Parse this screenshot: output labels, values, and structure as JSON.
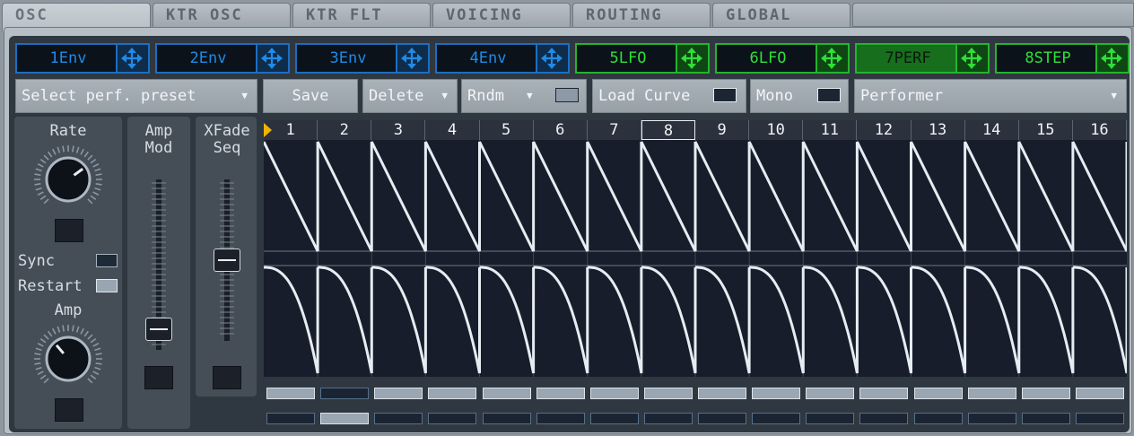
{
  "tabs": [
    "OSC",
    "KTR OSC",
    "KTR FLT",
    "VOICING",
    "ROUTING",
    "GLOBAL"
  ],
  "active_tab": "OSC",
  "mod_sources": [
    {
      "label": "1Env",
      "kind": "env",
      "selected": false
    },
    {
      "label": "2Env",
      "kind": "env",
      "selected": false
    },
    {
      "label": "3Env",
      "kind": "env",
      "selected": false
    },
    {
      "label": "4Env",
      "kind": "env",
      "selected": false
    },
    {
      "label": "5LFO",
      "kind": "lfo",
      "selected": false
    },
    {
      "label": "6LFO",
      "kind": "lfo",
      "selected": false
    },
    {
      "label": "7PERF",
      "kind": "lfo",
      "selected": true
    },
    {
      "label": "8STEP",
      "kind": "lfo",
      "selected": false
    }
  ],
  "toolbar": {
    "preset_select": "Select perf. preset",
    "save": "Save",
    "delete": "Delete",
    "rndm": "Rndm",
    "load_curve": "Load Curve",
    "mono": "Mono",
    "mode_select": "Performer"
  },
  "left_panel": {
    "rate_label": "Rate",
    "sync_label": "Sync",
    "restart_label": "Restart",
    "amp_label": "Amp",
    "rate_value": 0.7,
    "amp_value": 0.35,
    "sync_on": false,
    "restart_on": true
  },
  "amp_mod": {
    "label_line1": "Amp",
    "label_line2": "Mod",
    "value": 0.06
  },
  "xfade_seq": {
    "label_line1": "XFade",
    "label_line2": "Seq",
    "value": 0.5
  },
  "sequencer": {
    "steps": [
      "1",
      "2",
      "3",
      "4",
      "5",
      "6",
      "7",
      "8",
      "9",
      "10",
      "11",
      "12",
      "13",
      "14",
      "15",
      "16"
    ],
    "current_step": "8",
    "upper_curve": "ramp-down",
    "lower_curve": "exponential-decay",
    "row1_active": [
      true,
      false,
      true,
      true,
      true,
      true,
      true,
      true,
      true,
      true,
      true,
      true,
      true,
      true,
      true,
      true
    ],
    "row2_active": [
      false,
      true,
      false,
      false,
      false,
      false,
      false,
      false,
      false,
      false,
      false,
      false,
      false,
      false,
      false,
      false
    ]
  },
  "colors": {
    "env": "#1f8be8",
    "lfo": "#2ee038",
    "curve": "#e6edf2",
    "playhead": "#f0b400"
  }
}
